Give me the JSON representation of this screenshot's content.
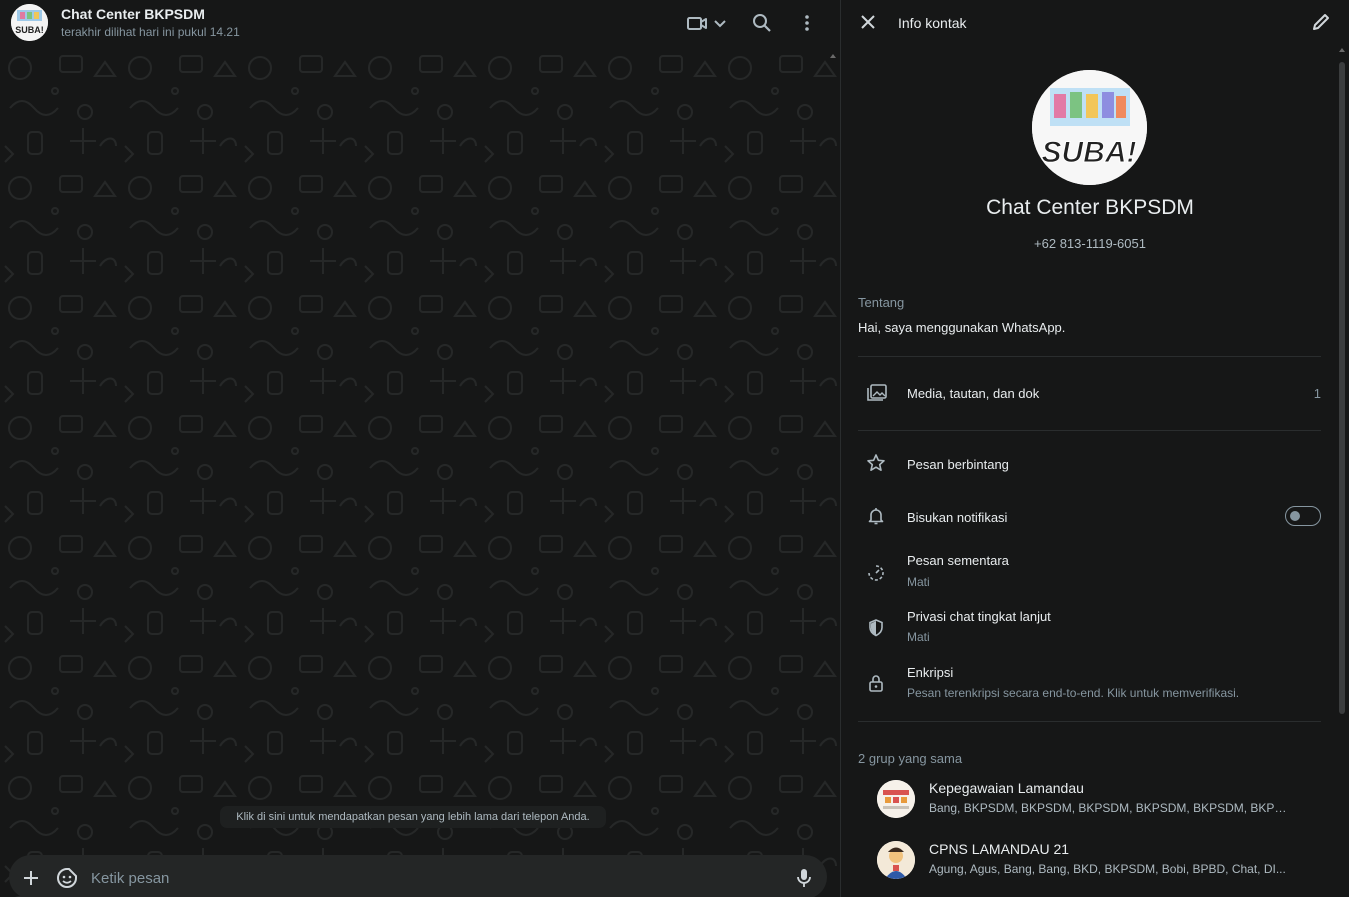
{
  "chat": {
    "title": "Chat Center BKPSDM",
    "status": "terakhir dilihat hari ini pukul 14.21",
    "older_messages_hint": "Klik di sini untuk mendapatkan pesan yang lebih lama dari telepon Anda.",
    "composer_placeholder": "Ketik pesan",
    "avatar_text": "SUBA!"
  },
  "info": {
    "title": "Info kontak",
    "name": "Chat Center BKPSDM",
    "phone": "+62 813-1119-6051",
    "avatar_text": "SUBA!",
    "about_label": "Tentang",
    "about_text": "Hai, saya menggunakan WhatsApp.",
    "media_label": "Media, tautan, dan dok",
    "media_count": "1",
    "starred_label": "Pesan berbintang",
    "mute_label": "Bisukan notifikasi",
    "mute_enabled": false,
    "disappearing_label": "Pesan sementara",
    "disappearing_value": "Mati",
    "privacy_label": "Privasi chat tingkat lanjut",
    "privacy_value": "Mati",
    "encryption_label": "Enkripsi",
    "encryption_text": "Pesan terenkripsi secara end-to-end. Klik untuk memverifikasi.",
    "groups_label": "2 grup yang sama",
    "groups": [
      {
        "name": "Kepegawaian Lamandau",
        "members": "Bang, BKPSDM, BKPSDM, BKPSDM, BKPSDM, BKPSDM, BKPS..."
      },
      {
        "name": "CPNS LAMANDAU 21",
        "members": "Agung, Agus, Bang, Bang, BKD, BKPSDM, Bobi, BPBD, Chat, DI..."
      }
    ]
  },
  "colors": {
    "background": "#161717",
    "composer": "#242626",
    "primary_text": "#e9edef",
    "secondary_text": "#8696a0",
    "accent": "#00a884"
  },
  "icons": [
    "video-call-icon",
    "chevron-down-icon",
    "search-icon",
    "menu-icon",
    "plus-icon",
    "sticker-icon",
    "mic-icon",
    "close-icon",
    "edit-icon",
    "media-icon",
    "star-icon",
    "bell-icon",
    "timer-icon",
    "shield-icon",
    "lock-icon"
  ]
}
